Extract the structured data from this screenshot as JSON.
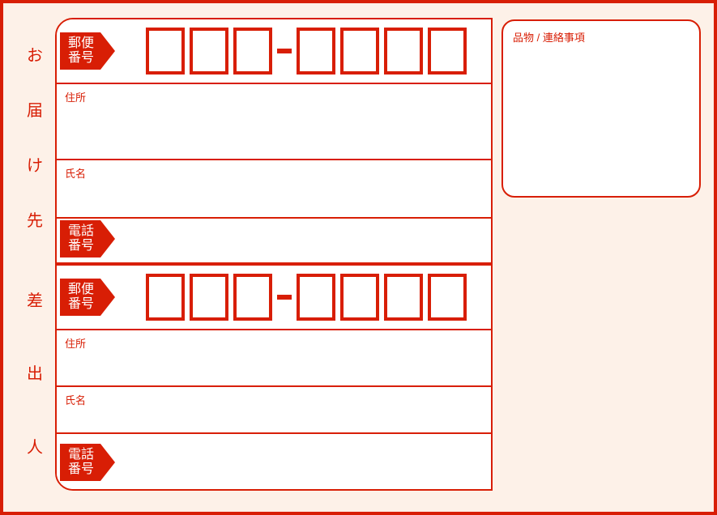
{
  "recipient": {
    "vertical_label": [
      "お",
      "届",
      "け",
      "先"
    ],
    "postal_tag": "郵便\n番号",
    "address_label": "住所",
    "name_label": "氏名",
    "phone_tag": "電話\n番号"
  },
  "sender": {
    "vertical_label": [
      "差",
      "出",
      "人"
    ],
    "postal_tag": "郵便\n番号",
    "address_label": "住所",
    "name_label": "氏名",
    "phone_tag": "電話\n番号"
  },
  "notes": {
    "label": "品物 / 連絡事項"
  },
  "colors": {
    "primary": "#d81e05",
    "background": "#fdf1e8"
  }
}
